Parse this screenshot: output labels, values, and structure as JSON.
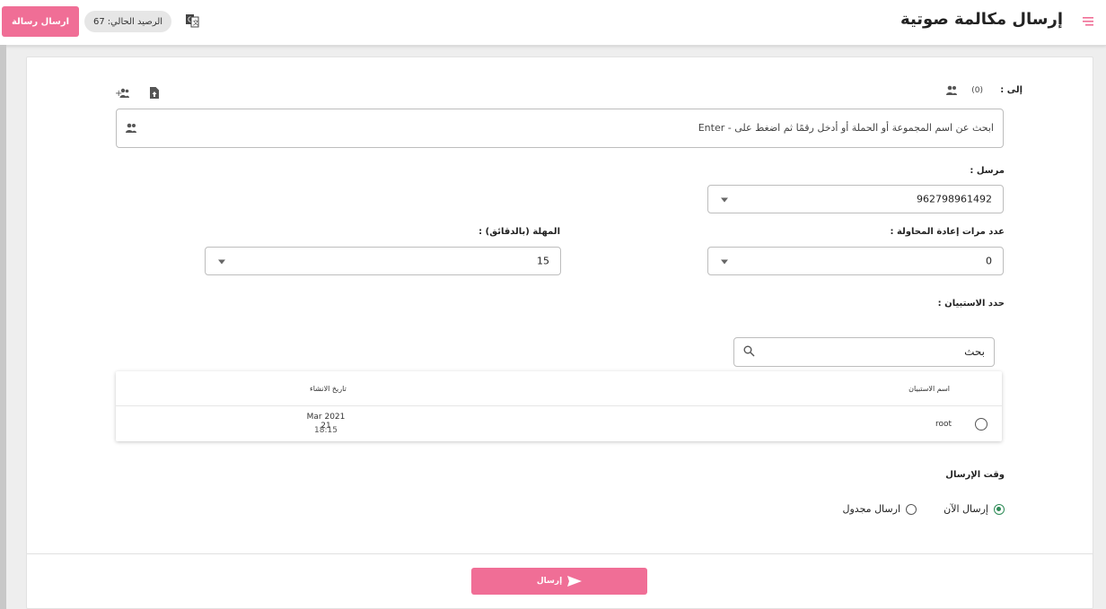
{
  "header": {
    "title": "إرسال مكالمة صوتية",
    "send_message_label": "ارسال رسالة",
    "balance_label": "الرصيد الحالي:",
    "balance_value": "67"
  },
  "recipients": {
    "to_label": "إلى :",
    "count": "(0)",
    "search_placeholder": "ابحث عن اسم المجموعة أو الحملة أو أدخل رقمًا ثم اضغط على - Enter"
  },
  "sender": {
    "label": "مرسل :",
    "value": "962798961492"
  },
  "retries": {
    "label": "عدد مرات إعادة المحاولة :",
    "value": "0"
  },
  "timeout": {
    "label": "المهلة (بالدقائق) :",
    "value": "15"
  },
  "survey": {
    "label": "حدد الاستبيان :",
    "search_placeholder": "بحث",
    "col_name": "اسم الاستبيان",
    "col_date": "تاريخ الانشاء",
    "rows": [
      {
        "name": "root",
        "date": "Mar 2021 21",
        "time": "18:15"
      }
    ]
  },
  "schedule": {
    "label": "وقت الإرسال",
    "now_label": "إرسال الآن",
    "scheduled_label": "ارسال مجدول"
  },
  "footer": {
    "send_label": "إرسال"
  },
  "colors": {
    "accent": "#f06e96",
    "radio_checked": "#2e8b57"
  }
}
